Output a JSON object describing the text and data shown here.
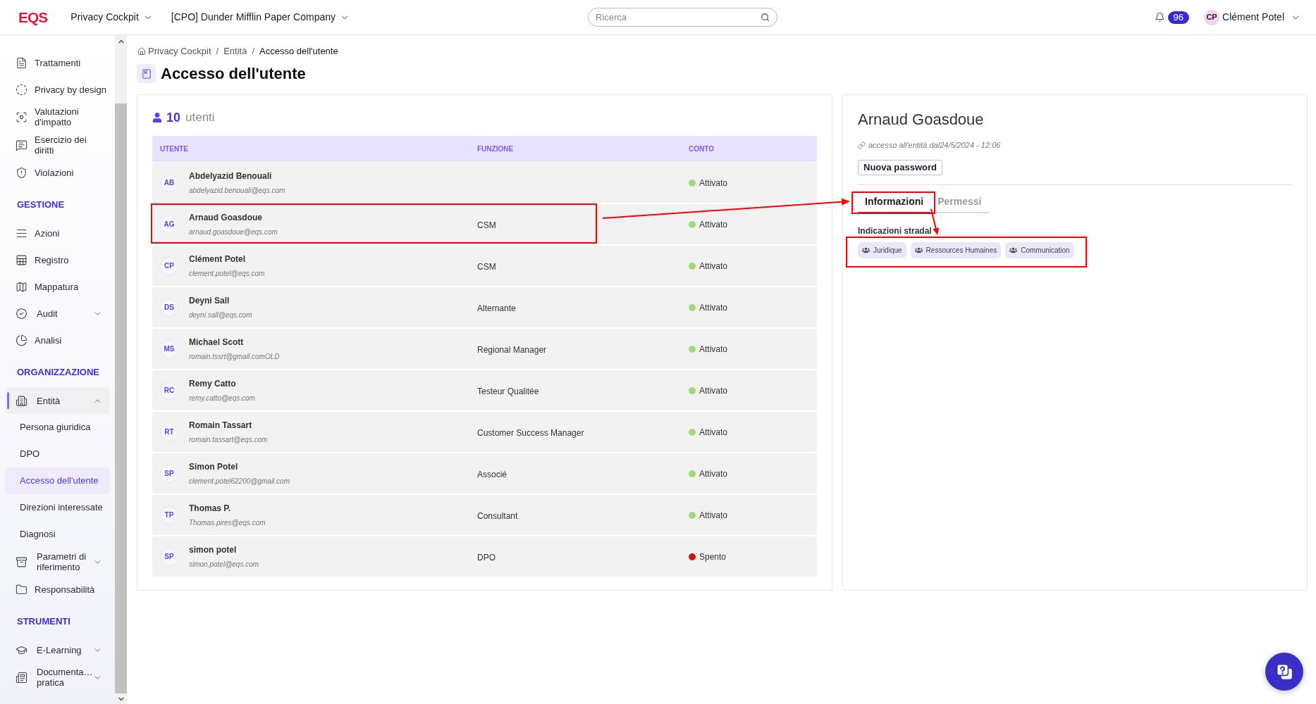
{
  "topbar": {
    "logo": "EQS",
    "app_menu": "Privacy Cockpit",
    "company_menu": "[CPO] Dunder Mifflin Paper Company",
    "search": {
      "placeholder": "Ricerca"
    },
    "notifications": "96",
    "user": {
      "initials": "CP",
      "name": "Clément Potel"
    }
  },
  "sidebar": {
    "sections": [
      {
        "items": [
          {
            "kind": "link",
            "label": "Trattamenti",
            "selected": false
          },
          {
            "kind": "link",
            "label": "Privacy by design",
            "selected": false
          },
          {
            "kind": "link",
            "label": "Valutazioni d'impatto",
            "selected": false
          },
          {
            "kind": "link",
            "label": "Esercizio dei diritti",
            "selected": false
          },
          {
            "kind": "link",
            "label": "Violazioni",
            "selected": false
          }
        ]
      },
      {
        "title": "GESTIONE",
        "items": [
          {
            "kind": "link",
            "label": "Azioni",
            "selected": false
          },
          {
            "kind": "link",
            "label": "Registro",
            "selected": false
          },
          {
            "kind": "link",
            "label": "Mappatura",
            "selected": false
          },
          {
            "kind": "group",
            "label": "Audit",
            "selected": false,
            "expanded": false
          },
          {
            "kind": "link",
            "label": "Analisi",
            "selected": false
          }
        ]
      },
      {
        "title": "ORGANIZZAZIONE",
        "items": [
          {
            "kind": "group",
            "label": "Entità",
            "selected": true,
            "expanded": true,
            "children": [
              {
                "label": "Persona giuridica",
                "selected": false
              },
              {
                "label": "DPO",
                "selected": false
              },
              {
                "label": "Accesso dell'utente",
                "selected": true
              },
              {
                "label": "Direzioni interessate",
                "selected": false
              },
              {
                "label": "Diagnosi",
                "selected": false
              }
            ]
          },
          {
            "kind": "group",
            "label": "Parametri di riferimento",
            "selected": false,
            "expanded": false
          },
          {
            "kind": "link",
            "label": "Responsabilità",
            "selected": false
          }
        ]
      },
      {
        "title": "STRUMENTI",
        "items": [
          {
            "kind": "group",
            "label": "E-Learning",
            "selected": false,
            "expanded": false
          },
          {
            "kind": "group",
            "label": "Documenta… pratica",
            "selected": false,
            "expanded": false
          }
        ]
      }
    ]
  },
  "breadcrumb": [
    {
      "kind": "link",
      "label": "Privacy Cockpit"
    },
    {
      "kind": "separator",
      "label": "/"
    },
    {
      "kind": "link",
      "label": "Entità"
    },
    {
      "kind": "separator",
      "label": "/"
    },
    {
      "kind": "current",
      "label": "Accesso dell'utente"
    }
  ],
  "page_title": "Accesso dell'utente",
  "users": {
    "count": "10",
    "count_label": "utenti",
    "columns": [
      "UTENTE",
      "FUNZIONE",
      "CONTO"
    ],
    "rows": [
      {
        "initials": "AB",
        "name": "Abdelyazid Benouali",
        "email": "abdelyazid.benouali@eqs.com",
        "status": {
          "label": "Attivato",
          "color": "#a2d977"
        }
      },
      {
        "initials": "AG",
        "name": "Arnaud Goasdoue",
        "email": "arnaud.goasdoue@eqs.com",
        "function": "CSM",
        "status": {
          "label": "Attivato",
          "color": "#a2d977"
        }
      },
      {
        "initials": "CP",
        "name": "Clément Potel",
        "email": "clement.potel@eqs.com",
        "function": "CSM",
        "status": {
          "label": "Attivato",
          "color": "#a2d977"
        }
      },
      {
        "initials": "DS",
        "name": "Deyni Sall",
        "email": "deyni.sall@eqs.com",
        "function": "Alternante",
        "status": {
          "label": "Attivato",
          "color": "#a2d977"
        }
      },
      {
        "initials": "MS",
        "name": "Michael Scott",
        "email": "romain.tssrt@gmail.comOLD",
        "function": "Regional Manager",
        "status": {
          "label": "Attivato",
          "color": "#a2d977"
        }
      },
      {
        "initials": "RC",
        "name": "Remy Catto",
        "email": "remy.catto@eqs.com",
        "function": "Testeur Qualitée",
        "status": {
          "label": "Attivato",
          "color": "#a2d977"
        }
      },
      {
        "initials": "RT",
        "name": "Romain Tassart",
        "email": "romain.tassart@eqs.com",
        "function": "Customer Success Manager",
        "status": {
          "label": "Attivato",
          "color": "#a2d977"
        }
      },
      {
        "initials": "SP",
        "name": "Simon Potel",
        "email": "clement.potel62200@gmail.com",
        "function": "Associé",
        "status": {
          "label": "Attivato",
          "color": "#a2d977"
        }
      },
      {
        "initials": "TP",
        "name": "Thomas P.",
        "email": "Thomas.pires@eqs.com",
        "function": "Consultant",
        "status": {
          "label": "Attivato",
          "color": "#a2d977"
        }
      },
      {
        "initials": "SP",
        "name": "simon potel",
        "email": "simon.potel@eqs.com",
        "function": "DPO",
        "status": {
          "label": "Spento",
          "color": "#d7150f"
        }
      }
    ]
  },
  "details": {
    "name": "Arnaud Goasdoue",
    "access_note": "accesso all'entità dal24/5/2024 - 12:06",
    "button": "Nuova password",
    "tabs": [
      {
        "label": "Informazioni",
        "selected": true
      },
      {
        "label": "Permessi",
        "selected": false
      }
    ],
    "section_label": "Indicazioni stradal",
    "tags": [
      "Juridique",
      "Ressources Humaines",
      "Communication"
    ]
  }
}
